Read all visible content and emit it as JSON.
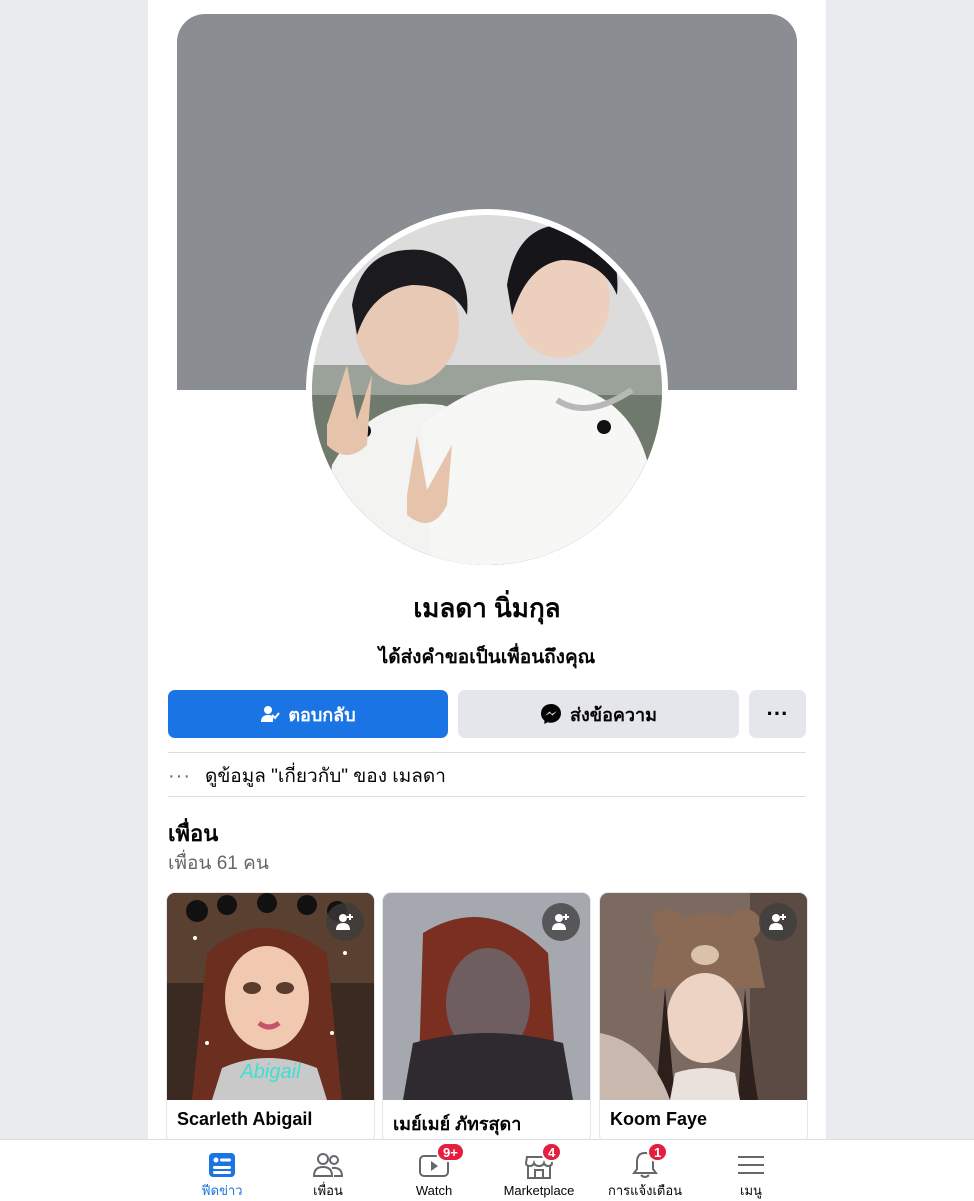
{
  "profile": {
    "name": "เมลดา นิ่มกุล",
    "request_text": "ได้ส่งคำขอเป็นเพื่อนถึงคุณ"
  },
  "actions": {
    "respond_label": "ตอบกลับ",
    "message_label": "ส่งข้อความ",
    "more_label": "···"
  },
  "about": {
    "dots": "···",
    "text": "ดูข้อมูล \"เกี่ยวกับ\" ของ เมลดา"
  },
  "friends": {
    "title": "เพื่อน",
    "count_text": "เพื่อน 61 คน",
    "items": [
      {
        "name": "Scarleth Abigail",
        "photo_caption": "Abigail"
      },
      {
        "name": "เมย์เมย์ ภัทรสุดา"
      },
      {
        "name": "Koom Faye"
      }
    ]
  },
  "tabbar": {
    "tabs": [
      {
        "label": "ฟีดข่าว",
        "icon": "news-feed-icon",
        "active": true
      },
      {
        "label": "เพื่อน",
        "icon": "friends-icon"
      },
      {
        "label": "Watch",
        "icon": "watch-icon",
        "badge": "9+"
      },
      {
        "label": "Marketplace",
        "icon": "marketplace-icon",
        "badge": "4"
      },
      {
        "label": "การแจ้งเตือน",
        "icon": "bell-icon",
        "badge": "1"
      },
      {
        "label": "เมนู",
        "icon": "menu-icon"
      }
    ]
  },
  "colors": {
    "primary": "#1b74e4",
    "cover": "#8a8d91",
    "secondary_button": "#e4e6eb",
    "badge": "#e41e3f"
  }
}
